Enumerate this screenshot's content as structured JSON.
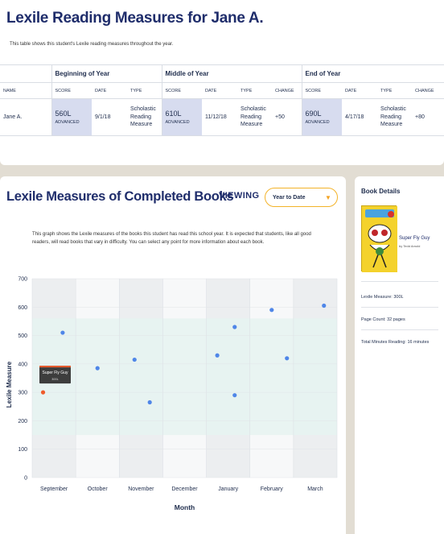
{
  "report": {
    "title": "Lexile Reading Measures for Jane A.",
    "description": "This table shows this student's Lexile reading measures throughout the year.",
    "groups": [
      "Beginning of Year",
      "Middle of Year",
      "End of Year"
    ],
    "columns": {
      "name": "NAME",
      "boy": [
        "SCORE",
        "DATE",
        "TYPE"
      ],
      "moy": [
        "SCORE",
        "DATE",
        "TYPE",
        "CHANGE"
      ],
      "eoy": [
        "SCORE",
        "DATE",
        "TYPE",
        "CHANGE"
      ]
    },
    "row": {
      "name": "Jane A.",
      "boy": {
        "score": "560L",
        "level": "ADVANCED",
        "date": "9/1/18",
        "type": "Scholastic Reading Measure"
      },
      "moy": {
        "score": "610L",
        "level": "ADVANCED",
        "date": "11/12/18",
        "type": "Scholastic Reading Measure",
        "change": "+50"
      },
      "eoy": {
        "score": "690L",
        "level": "ADVANCED",
        "date": "4/17/18",
        "type": "Scholastic Reading Measure",
        "change": "+80"
      }
    }
  },
  "books": {
    "title": "Lexile Measures of Completed Books",
    "viewing_label": "VIEWING",
    "range_selected": "Year to Date",
    "description": "This graph shows the Lexile measures of the books this student has read this school year. It is expected that students, like all good readers, will read books that vary in difficulty. You can select any point for more information about each book.",
    "tooltip": {
      "title": "Super Fly Guy",
      "value": "300L"
    }
  },
  "chart_data": {
    "type": "scatter",
    "xlabel": "Month",
    "ylabel": "Lexile Measure",
    "categories": [
      "September",
      "October",
      "November",
      "December",
      "January",
      "February",
      "March"
    ],
    "ylim": [
      0,
      700
    ],
    "yticks": [
      0,
      100,
      200,
      300,
      400,
      500,
      600,
      700
    ],
    "expected_band": [
      150,
      560
    ],
    "points": [
      {
        "month": "September",
        "offset": -0.25,
        "y": 300,
        "selected": true
      },
      {
        "month": "September",
        "offset": 0.2,
        "y": 510
      },
      {
        "month": "October",
        "offset": 0.0,
        "y": 385
      },
      {
        "month": "November",
        "offset": -0.15,
        "y": 415
      },
      {
        "month": "November",
        "offset": 0.2,
        "y": 265
      },
      {
        "month": "January",
        "offset": -0.25,
        "y": 430
      },
      {
        "month": "January",
        "offset": 0.15,
        "y": 530
      },
      {
        "month": "January",
        "offset": 0.15,
        "y": 290
      },
      {
        "month": "February",
        "offset": 0.0,
        "y": 590
      },
      {
        "month": "February",
        "offset": 0.35,
        "y": 420
      },
      {
        "month": "March",
        "offset": 0.2,
        "y": 605
      }
    ],
    "colors": {
      "point": "#4f86e8",
      "selected": "#ef5b2b",
      "band": "#e6f3f1"
    }
  },
  "details": {
    "title": "Book Details",
    "book_title": "Super Fly Guy",
    "book_author": "by Tedd Arnold",
    "lexile": "Lexile Measure: 300L",
    "pages": "Page Count: 32 pages",
    "minutes": "Total Minutes Reading: 16 minutes"
  }
}
